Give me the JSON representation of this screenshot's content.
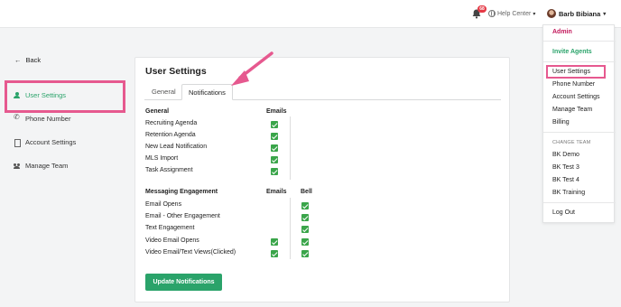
{
  "topbar": {
    "notification_count": "68",
    "help_label": "Help Center",
    "user_name": "Barb Bibiana"
  },
  "nav": {
    "back_label": "Back",
    "items": [
      {
        "label": "User Settings"
      },
      {
        "label": "Phone Number"
      },
      {
        "label": "Account Settings"
      },
      {
        "label": "Manage Team"
      }
    ]
  },
  "card": {
    "title": "User Settings",
    "tabs": [
      {
        "label": "General"
      },
      {
        "label": "Notifications"
      }
    ],
    "general": {
      "heading": "General",
      "emails_col": "Emails",
      "rows": [
        {
          "label": "Recruiting Agenda",
          "email": true
        },
        {
          "label": "Retention Agenda",
          "email": true
        },
        {
          "label": "New Lead Notification",
          "email": true
        },
        {
          "label": "MLS Import",
          "email": true
        },
        {
          "label": "Task Assignment",
          "email": true
        }
      ]
    },
    "messaging": {
      "heading": "Messaging Engagement",
      "emails_col": "Emails",
      "bell_col": "Bell",
      "rows": [
        {
          "label": "Email Opens",
          "email": false,
          "bell": true
        },
        {
          "label": "Email - Other Engagement",
          "email": false,
          "bell": true
        },
        {
          "label": "Text Engagement",
          "email": false,
          "bell": true
        },
        {
          "label": "Video Email Opens",
          "email": true,
          "bell": true
        },
        {
          "label": "Video Email/Text Views(Clicked)",
          "email": true,
          "bell": true
        }
      ]
    },
    "button_label": "Update Notifications"
  },
  "menu": {
    "admin": "Admin",
    "invite": "Invite Agents",
    "items": [
      {
        "label": "User Settings"
      },
      {
        "label": "Phone Number"
      },
      {
        "label": "Account Settings"
      },
      {
        "label": "Manage Team"
      },
      {
        "label": "Billing"
      }
    ],
    "change_team_header": "CHANGE TEAM",
    "teams": [
      {
        "label": "BK Demo"
      },
      {
        "label": "BK Test 3"
      },
      {
        "label": "BK Test 4"
      },
      {
        "label": "BK Training"
      }
    ],
    "logout": "Log Out"
  },
  "colors": {
    "accent_green": "#2aa36a",
    "highlight_pink": "#e6598f",
    "admin_red": "#c2185b",
    "checkbox_green": "#3aa54a"
  }
}
